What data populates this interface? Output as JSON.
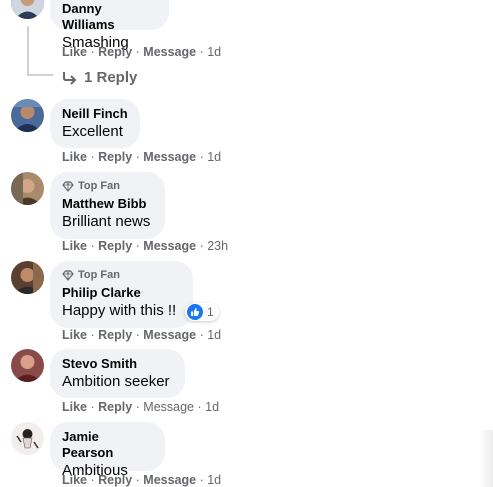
{
  "comments": [
    {
      "name": "Danny Williams",
      "text": "Smashing",
      "top_fan": "",
      "actions": {
        "like": "Like",
        "reply": "Reply",
        "message": "Message",
        "time": "1d"
      },
      "avatar_color": "#3b4a66",
      "replies_label": "1 Reply"
    },
    {
      "name": "Neill Finch",
      "text": "Excellent",
      "top_fan": "",
      "actions": {
        "like": "Like",
        "reply": "Reply",
        "message": "Message",
        "time": "1d"
      },
      "avatar_color": "#2d4a7a"
    },
    {
      "name": "Matthew Bibb",
      "text": "Brilliant news",
      "top_fan": "Top Fan",
      "actions": {
        "like": "Like",
        "reply": "Reply",
        "message": "Message",
        "time": "23h"
      },
      "avatar_color": "#8a6a4a"
    },
    {
      "name": "Philip Clarke",
      "text": "Happy with this !!",
      "top_fan": "Top Fan",
      "actions": {
        "like": "Like",
        "reply": "Reply",
        "message": "Message",
        "time": "1d"
      },
      "avatar_color": "#6b4e3a",
      "reaction": {
        "icon": "like-icon",
        "count": "1",
        "color": "#1877f2"
      }
    },
    {
      "name": "Stevo Smith",
      "text": "Ambition seeker",
      "top_fan": "",
      "actions": {
        "like": "Like",
        "reply": "Reply",
        "message": "Message",
        "time": "1d"
      },
      "avatar_color": "#7a3a3a"
    },
    {
      "name": "Jamie Pearson",
      "text": "Ambitious",
      "top_fan": "",
      "actions": {
        "like": "Like",
        "reply": "Reply",
        "message": "Message",
        "time": "1d"
      },
      "avatar_color": "#e8e0e0"
    }
  ]
}
